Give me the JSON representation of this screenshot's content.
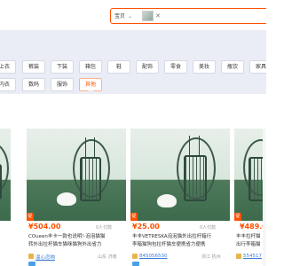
{
  "search": {
    "scope_label": "宝贝",
    "chevron_icon": "chevron-down-icon",
    "image_thumb_icon": "image-thumbnail-icon",
    "close_icon": "close-icon",
    "close_glyph": "✕",
    "chevron_glyph": "⌄"
  },
  "categories": {
    "row1": [
      "上衣",
      "裤装",
      "下装",
      "箱包",
      "鞋",
      "配饰",
      "零食",
      "美妆",
      "瓶饮",
      "家具"
    ],
    "row2": [
      "内衣",
      "数码",
      "服饰",
      "其他"
    ],
    "active": "其他"
  },
  "products": [
    {
      "price": "",
      "pay_count": "",
      "title_line1": "",
      "title_line2": "",
      "shop": "",
      "location": ""
    },
    {
      "price": "¥504.00",
      "pay_count": "0人付款",
      "title_line1": "COueen丰卡一款也说明!·泡泡猫猫",
      "title_line2": "转外出拉杆猫车猫咪猫狗外出省力",
      "shop": "温心恋物",
      "location": "山东 济南"
    },
    {
      "price": "¥25.00",
      "pay_count": "0人付款",
      "title_line1": "丰丰VETRESKA泡泡猫外出拉杆箱行",
      "title_line2": "李箱猫狗包拉杆猫车便携省力便携",
      "shop": "845056530",
      "location": "浙江 杭州"
    },
    {
      "price": "¥489.00",
      "pay_count": "",
      "title_line1": "丰丰拉杆猫",
      "title_line2": "出行李箱猫",
      "shop": "554517",
      "location": ""
    }
  ],
  "colors": {
    "accent": "#ff5000",
    "panel": "#eaedf6",
    "link": "#3c7ed8"
  }
}
